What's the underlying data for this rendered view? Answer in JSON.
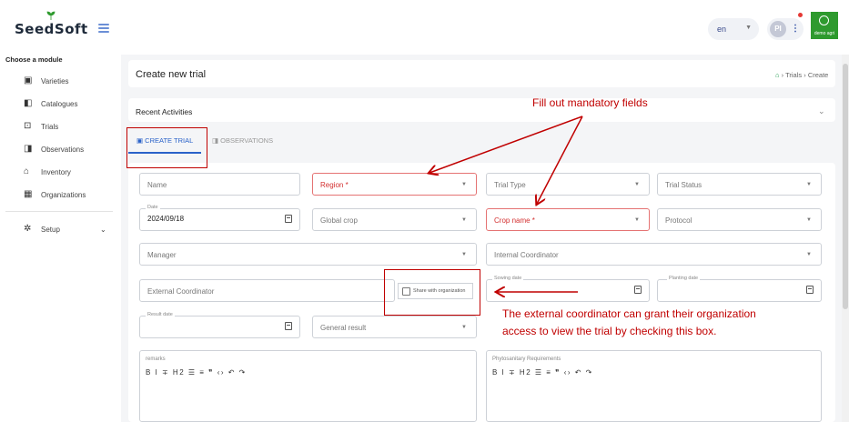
{
  "app": {
    "logo": "SeedSoft",
    "brand_caption": "demo agri"
  },
  "header": {
    "language": "en",
    "avatar_initials": "PI"
  },
  "sidebar": {
    "heading": "Choose a module",
    "items": [
      {
        "label": "Varieties",
        "icon": "clipboard-icon"
      },
      {
        "label": "Catalogues",
        "icon": "book-icon"
      },
      {
        "label": "Trials",
        "icon": "flask-icon"
      },
      {
        "label": "Observations",
        "icon": "eye-icon"
      },
      {
        "label": "Inventory",
        "icon": "warehouse-icon"
      },
      {
        "label": "Organizations",
        "icon": "building-icon"
      }
    ],
    "setup": {
      "label": "Setup",
      "icon": "gear-icon"
    }
  },
  "page": {
    "title": "Create new trial",
    "breadcrumb": [
      "Trials",
      "Create"
    ],
    "recent_activities": "Recent Activities"
  },
  "tabs": [
    {
      "label": "CREATE TRIAL",
      "active": true
    },
    {
      "label": "OBSERVATIONS",
      "active": false
    }
  ],
  "form": {
    "name": "Name",
    "region": "Region *",
    "trial_type": "Trial Type",
    "trial_status": "Trial Status",
    "date_label": "Date",
    "date_value": "2024/09/18",
    "global_crop": "Global crop",
    "crop_name": "Crop name *",
    "protocol": "Protocol",
    "manager": "Manager",
    "internal_coordinator": "Internal Coordinator",
    "external_coordinator": "External Coordinator",
    "share_with_org": "Share with organization",
    "sowing_date": "Sowing date",
    "planting_date": "Planting date",
    "result_date": "Result date",
    "general_result": "General result",
    "remarks": "remarks",
    "phyto": "Phytosanitary Requirements",
    "toolbar": "B I ∓ H2 ☰ ≡ ❞ ‹› ↶ ↷"
  },
  "annotations": {
    "mandatory": "Fill out mandatory fields",
    "share_line1": "The external coordinator can grant their organization",
    "share_line2": "access to view the trial by checking this box."
  },
  "colors": {
    "accent": "#2a62c9",
    "annotation": "#c00000",
    "brand": "#2e9a2e",
    "required": "#d32f2f"
  }
}
